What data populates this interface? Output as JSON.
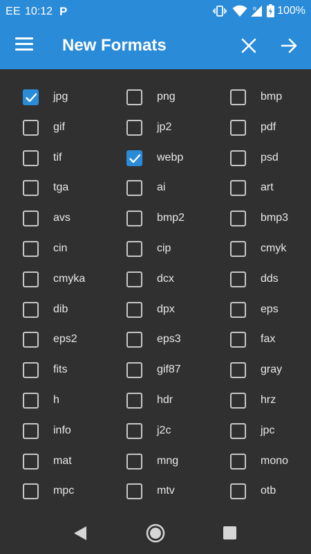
{
  "status_bar": {
    "carrier": "EE",
    "time": "10:12",
    "notification_icon": "P",
    "battery": "100%",
    "icons": [
      "vibrate-icon",
      "wifi-icon",
      "signal-icon",
      "battery-icon"
    ]
  },
  "toolbar": {
    "title": "New Formats",
    "icons": [
      "menu-icon",
      "close-icon",
      "arrow-right-icon"
    ]
  },
  "colors": {
    "accent": "#2a8bd8",
    "background": "#303030",
    "text": "#e8e8e8"
  },
  "formats": [
    {
      "label": "jpg",
      "checked": true
    },
    {
      "label": "png",
      "checked": false
    },
    {
      "label": "bmp",
      "checked": false
    },
    {
      "label": "gif",
      "checked": false
    },
    {
      "label": "jp2",
      "checked": false
    },
    {
      "label": "pdf",
      "checked": false
    },
    {
      "label": "tif",
      "checked": false
    },
    {
      "label": "webp",
      "checked": true
    },
    {
      "label": "psd",
      "checked": false
    },
    {
      "label": "tga",
      "checked": false
    },
    {
      "label": "ai",
      "checked": false
    },
    {
      "label": "art",
      "checked": false
    },
    {
      "label": "avs",
      "checked": false
    },
    {
      "label": "bmp2",
      "checked": false
    },
    {
      "label": "bmp3",
      "checked": false
    },
    {
      "label": "cin",
      "checked": false
    },
    {
      "label": "cip",
      "checked": false
    },
    {
      "label": "cmyk",
      "checked": false
    },
    {
      "label": "cmyka",
      "checked": false
    },
    {
      "label": "dcx",
      "checked": false
    },
    {
      "label": "dds",
      "checked": false
    },
    {
      "label": "dib",
      "checked": false
    },
    {
      "label": "dpx",
      "checked": false
    },
    {
      "label": "eps",
      "checked": false
    },
    {
      "label": "eps2",
      "checked": false
    },
    {
      "label": "eps3",
      "checked": false
    },
    {
      "label": "fax",
      "checked": false
    },
    {
      "label": "fits",
      "checked": false
    },
    {
      "label": "gif87",
      "checked": false
    },
    {
      "label": "gray",
      "checked": false
    },
    {
      "label": "h",
      "checked": false
    },
    {
      "label": "hdr",
      "checked": false
    },
    {
      "label": "hrz",
      "checked": false
    },
    {
      "label": "info",
      "checked": false
    },
    {
      "label": "j2c",
      "checked": false
    },
    {
      "label": "jpc",
      "checked": false
    },
    {
      "label": "mat",
      "checked": false
    },
    {
      "label": "mng",
      "checked": false
    },
    {
      "label": "mono",
      "checked": false
    },
    {
      "label": "mpc",
      "checked": false
    },
    {
      "label": "mtv",
      "checked": false
    },
    {
      "label": "otb",
      "checked": false
    }
  ],
  "nav_bar": {
    "icons": [
      "back-icon",
      "home-icon",
      "recents-icon"
    ]
  }
}
